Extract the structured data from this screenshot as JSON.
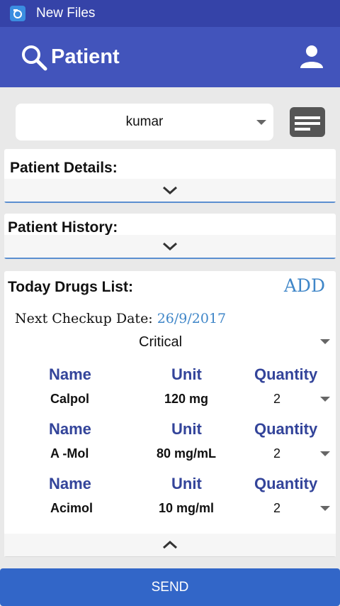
{
  "status_bar": {
    "app_title": "New Files"
  },
  "toolbar": {
    "title": "Patient"
  },
  "patient_select": {
    "value": "kumar"
  },
  "patient_details": {
    "heading": "Patient Details:"
  },
  "patient_history": {
    "heading": "Patient History:"
  },
  "drugs": {
    "heading": "Today Drugs List:",
    "add_label": "ADD",
    "checkup_label": "Next Checkup Date:",
    "checkup_date": "26/9/2017",
    "priority": "Critical",
    "column_headers": {
      "name": "Name",
      "unit": "Unit",
      "quantity": "Quantity"
    },
    "items": [
      {
        "name": "Calpol",
        "unit": "120 mg",
        "quantity": "2"
      },
      {
        "name": "A -Mol",
        "unit": "80 mg/mL",
        "quantity": "2"
      },
      {
        "name": "Acimol",
        "unit": "10 mg/ml",
        "quantity": "2"
      }
    ]
  },
  "send_label": "SEND",
  "colors": {
    "status_bar": "#3543a8",
    "toolbar": "#4254bb",
    "accent_blue": "#3f86c8",
    "header_text": "#33449a",
    "send_button": "#3266c8"
  },
  "icons": [
    "app-icon",
    "search-icon",
    "person-icon",
    "document-icon",
    "chevron-down-icon",
    "chevron-up-icon"
  ]
}
